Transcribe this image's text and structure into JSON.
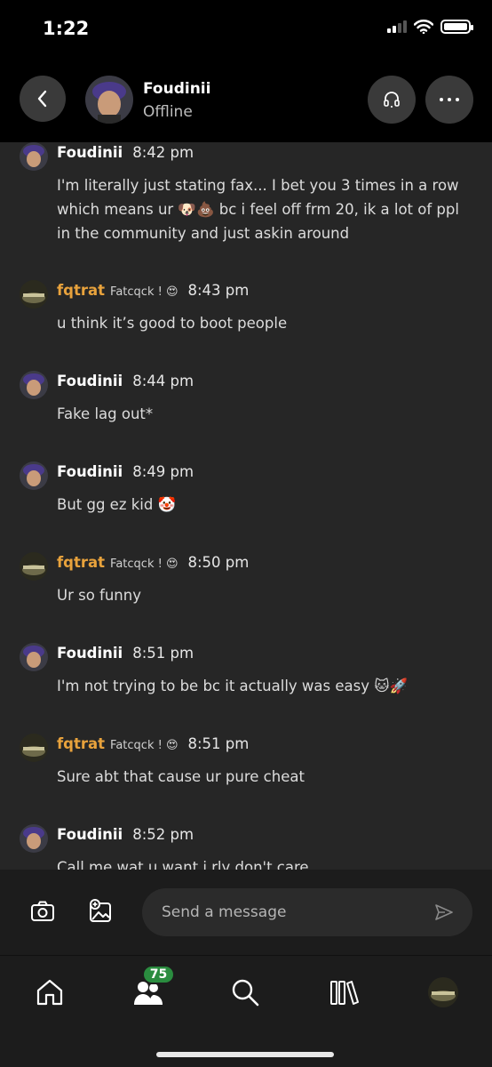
{
  "status_bar": {
    "time": "1:22"
  },
  "header": {
    "name": "Foudinii",
    "status": "Offline"
  },
  "messages": [
    {
      "author": "Foudinii",
      "author_sub": "",
      "time": "8:42 pm",
      "text": "I'm literally just stating fax... I bet you 3 times in a row which means ur 🐶💩 bc i feel off frm 20, ik a lot of ppl in the community and just askin around"
    },
    {
      "author": "fqtrat",
      "author_sub": "Fatcqck ! 😍",
      "time": "8:43 pm",
      "text": "u think it’s good to boot people"
    },
    {
      "author": "Foudinii",
      "author_sub": "",
      "time": "8:44 pm",
      "text": "Fake lag out*"
    },
    {
      "author": "Foudinii",
      "author_sub": "",
      "time": "8:49 pm",
      "text": "But gg ez kid 🤡"
    },
    {
      "author": "fqtrat",
      "author_sub": "Fatcqck ! 😍",
      "time": "8:50 pm",
      "text": "Ur so funny"
    },
    {
      "author": "Foudinii",
      "author_sub": "",
      "time": "8:51 pm",
      "text": "I'm not trying to be bc it actually was easy 🐱🚀"
    },
    {
      "author": "fqtrat",
      "author_sub": "Fatcqck ! 😍",
      "time": "8:51 pm",
      "text": "Sure abt that cause ur pure cheat"
    },
    {
      "author": "Foudinii",
      "author_sub": "",
      "time": "8:52 pm",
      "text": "Call me wat u want i rly don't care"
    }
  ],
  "composer": {
    "placeholder": "Send a message"
  },
  "tabbar": {
    "friends_badge": "75"
  },
  "colors": {
    "background": "#262626",
    "header": "#000000",
    "accent_name": "#e8a23c",
    "badge": "#2a8c3f"
  }
}
